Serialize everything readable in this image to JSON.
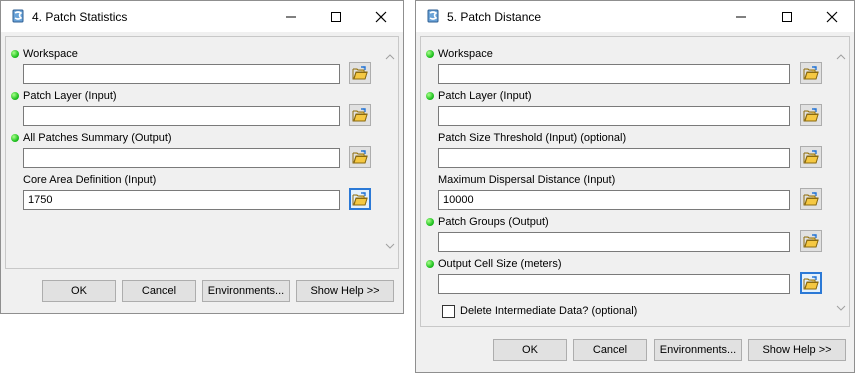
{
  "colors": {
    "accent": "#2b79d6",
    "required_dot": "#22c322"
  },
  "icons": {
    "app": "toolbox-icon",
    "browse": "open-folder-icon",
    "minimize": "minimize-icon",
    "maximize": "maximize-icon",
    "close": "close-icon"
  },
  "left": {
    "title": "4. Patch Statistics",
    "params": [
      {
        "label": "Workspace",
        "value": ""
      },
      {
        "label": "Patch Layer (Input)",
        "value": ""
      },
      {
        "label": "All Patches Summary (Output)",
        "value": ""
      },
      {
        "label": "Core Area Definition (Input)",
        "value": "1750"
      }
    ],
    "buttons": {
      "ok": "OK",
      "cancel": "Cancel",
      "env": "Environments...",
      "help": "Show Help >>"
    }
  },
  "right": {
    "title": "5. Patch Distance",
    "params": [
      {
        "label": "Workspace",
        "value": ""
      },
      {
        "label": "Patch Layer (Input)",
        "value": ""
      },
      {
        "label": "Patch Size Threshold (Input) (optional)",
        "value": ""
      },
      {
        "label": "Maximum Dispersal Distance (Input)",
        "value": "10000"
      },
      {
        "label": "Patch Groups (Output)",
        "value": ""
      },
      {
        "label": "Output Cell Size (meters)",
        "value": ""
      }
    ],
    "checkbox": {
      "label": "Delete Intermediate Data? (optional)",
      "checked": false
    },
    "buttons": {
      "ok": "OK",
      "cancel": "Cancel",
      "env": "Environments...",
      "help": "Show Help >>"
    }
  }
}
